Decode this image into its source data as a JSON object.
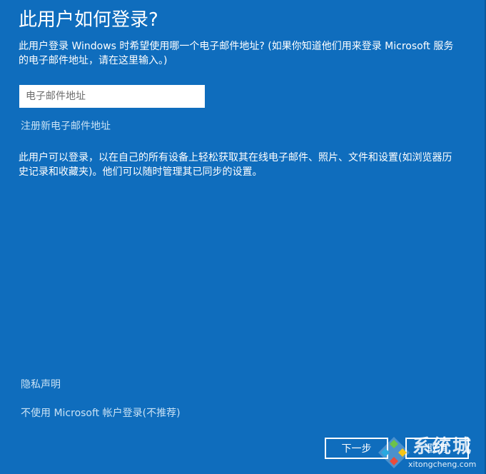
{
  "dialog": {
    "title": "此用户如何登录?",
    "description": "此用户登录 Windows 时希望使用哪一个电子邮件地址? (如果你知道他们用来登录 Microsoft 服务的电子邮件地址，请在这里输入。)",
    "email": {
      "placeholder": "电子邮件地址",
      "value": ""
    },
    "signup_link": "注册新电子邮件地址",
    "info": "此用户可以登录，以在自己的所有设备上轻松获取其在线电子邮件、照片、文件和设置(如浏览器历史记录和收藏夹)。他们可以随时管理其已同步的设置。",
    "privacy_link": "隐私声明",
    "no_ms_account_link": "不使用 Microsoft 帐户登录(不推荐)",
    "buttons": {
      "next": "下一步",
      "cancel": "取消"
    }
  },
  "watermark": {
    "brand": "系统城",
    "site": "xitongcheng.com",
    "icon": "diamond-logo-icon"
  },
  "colors": {
    "background": "#0f6dbd",
    "link": "#c9e2f5",
    "text": "#ffffff"
  }
}
